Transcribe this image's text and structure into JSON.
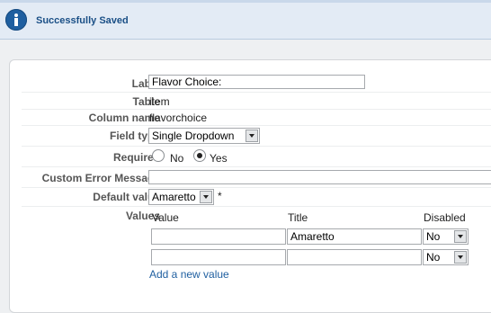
{
  "notice": {
    "text": "Successfully Saved",
    "icon": "info-icon"
  },
  "form": {
    "label": {
      "label": "Label",
      "value": "Flavor Choice:"
    },
    "table": {
      "label": "Table",
      "value": "item"
    },
    "column_name": {
      "label": "Column name",
      "value": "flavorchoice"
    },
    "field_type": {
      "label": "Field type",
      "value": "Single Dropdown"
    },
    "required": {
      "label": "Required",
      "options": [
        "No",
        "Yes"
      ],
      "selected": "Yes"
    },
    "custom_error": {
      "label": "Custom Error Message",
      "value": ""
    },
    "default_value": {
      "label": "Default value",
      "value": "Amaretto",
      "required_marker": "*"
    },
    "values": {
      "label": "Values",
      "columns": [
        "Value",
        "Title",
        "Disabled"
      ],
      "rows": [
        {
          "value": "",
          "title": "Amaretto",
          "disabled": "No"
        },
        {
          "value": "",
          "title": "",
          "disabled": "No"
        }
      ],
      "add_link": "Add a new value"
    }
  }
}
